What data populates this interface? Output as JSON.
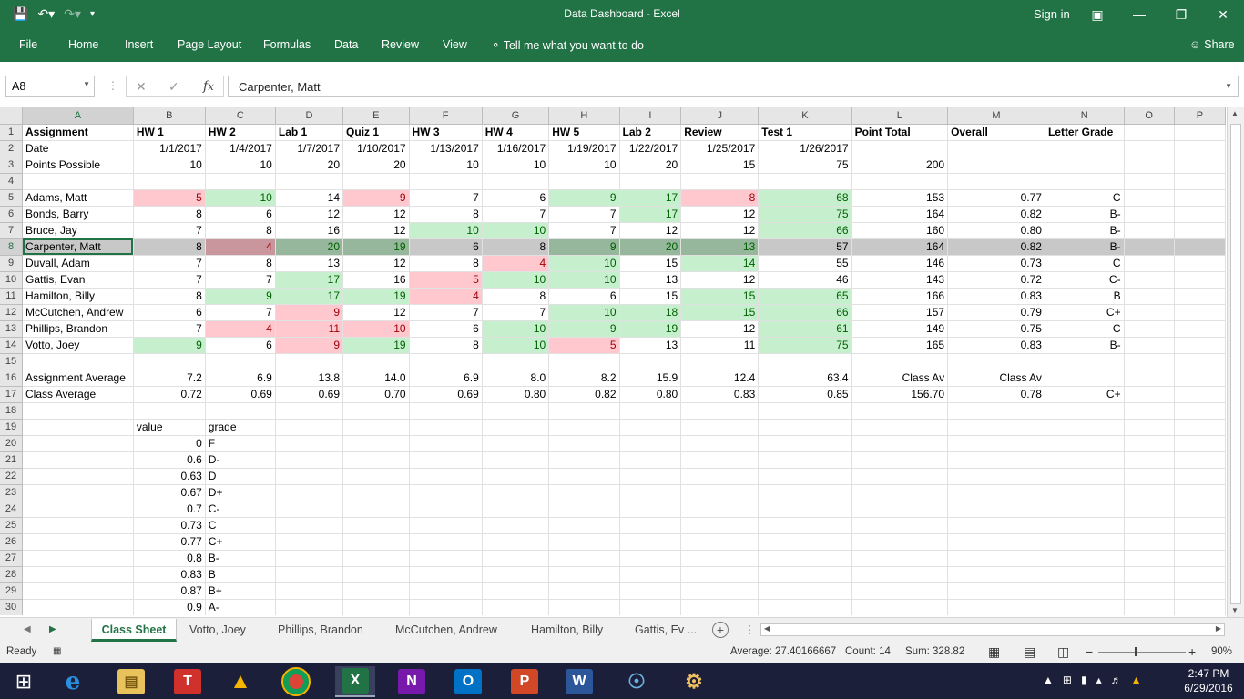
{
  "window": {
    "title": "Data Dashboard - Excel",
    "sign_in": "Sign in"
  },
  "ribbon": {
    "tabs": [
      "File",
      "Home",
      "Insert",
      "Page Layout",
      "Formulas",
      "Data",
      "Review",
      "View"
    ],
    "tell_me": "Tell me what you want to do",
    "share": "Share"
  },
  "formula_bar": {
    "name_box": "A8",
    "value": "Carpenter, Matt"
  },
  "columns": [
    "A",
    "B",
    "C",
    "D",
    "E",
    "F",
    "G",
    "H",
    "I",
    "J",
    "K",
    "L",
    "M",
    "N",
    "O",
    "P"
  ],
  "rows": [
    {
      "n": "1",
      "cells": [
        {
          "v": "Assignment",
          "b": 1
        },
        {
          "v": "HW 1",
          "b": 1
        },
        {
          "v": "HW 2",
          "b": 1
        },
        {
          "v": "Lab 1",
          "b": 1
        },
        {
          "v": "Quiz 1",
          "b": 1
        },
        {
          "v": "HW 3",
          "b": 1
        },
        {
          "v": "HW 4",
          "b": 1
        },
        {
          "v": "HW 5",
          "b": 1
        },
        {
          "v": "Lab 2",
          "b": 1
        },
        {
          "v": "Review",
          "b": 1
        },
        {
          "v": "Test 1",
          "b": 1
        },
        {
          "v": "Point Total",
          "b": 1
        },
        {
          "v": "Overall",
          "b": 1
        },
        {
          "v": "Letter Grade",
          "b": 1
        },
        {
          "v": ""
        },
        {
          "v": ""
        }
      ]
    },
    {
      "n": "2",
      "cells": [
        {
          "v": "Date"
        },
        {
          "v": "1/1/2017",
          "r": 1
        },
        {
          "v": "1/4/2017",
          "r": 1
        },
        {
          "v": "1/7/2017",
          "r": 1
        },
        {
          "v": "1/10/2017",
          "r": 1
        },
        {
          "v": "1/13/2017",
          "r": 1
        },
        {
          "v": "1/16/2017",
          "r": 1
        },
        {
          "v": "1/19/2017",
          "r": 1
        },
        {
          "v": "1/22/2017",
          "r": 1
        },
        {
          "v": "1/25/2017",
          "r": 1
        },
        {
          "v": "1/26/2017",
          "r": 1
        },
        {
          "v": ""
        },
        {
          "v": ""
        },
        {
          "v": ""
        },
        {
          "v": ""
        },
        {
          "v": ""
        }
      ]
    },
    {
      "n": "3",
      "cells": [
        {
          "v": "Points Possible"
        },
        {
          "v": "10",
          "r": 1
        },
        {
          "v": "10",
          "r": 1
        },
        {
          "v": "20",
          "r": 1
        },
        {
          "v": "20",
          "r": 1
        },
        {
          "v": "10",
          "r": 1
        },
        {
          "v": "10",
          "r": 1
        },
        {
          "v": "10",
          "r": 1
        },
        {
          "v": "20",
          "r": 1
        },
        {
          "v": "15",
          "r": 1
        },
        {
          "v": "75",
          "r": 1
        },
        {
          "v": "200",
          "r": 1
        },
        {
          "v": ""
        },
        {
          "v": ""
        },
        {
          "v": ""
        },
        {
          "v": ""
        }
      ]
    },
    {
      "n": "4",
      "cells": []
    },
    {
      "n": "5",
      "cells": [
        {
          "v": "Adams, Matt"
        },
        {
          "v": "5",
          "r": 1,
          "c": "cr"
        },
        {
          "v": "10",
          "r": 1,
          "c": "cg"
        },
        {
          "v": "14",
          "r": 1
        },
        {
          "v": "9",
          "r": 1,
          "c": "cr"
        },
        {
          "v": "7",
          "r": 1
        },
        {
          "v": "6",
          "r": 1
        },
        {
          "v": "9",
          "r": 1,
          "c": "cg"
        },
        {
          "v": "17",
          "r": 1,
          "c": "cg"
        },
        {
          "v": "8",
          "r": 1,
          "c": "cr"
        },
        {
          "v": "68",
          "r": 1,
          "c": "cg"
        },
        {
          "v": "153",
          "r": 1
        },
        {
          "v": "0.77",
          "r": 1
        },
        {
          "v": "C",
          "r": 1
        },
        {
          "v": ""
        },
        {
          "v": ""
        }
      ]
    },
    {
      "n": "6",
      "cells": [
        {
          "v": "Bonds, Barry"
        },
        {
          "v": "8",
          "r": 1
        },
        {
          "v": "6",
          "r": 1
        },
        {
          "v": "12",
          "r": 1
        },
        {
          "v": "12",
          "r": 1
        },
        {
          "v": "8",
          "r": 1
        },
        {
          "v": "7",
          "r": 1
        },
        {
          "v": "7",
          "r": 1
        },
        {
          "v": "17",
          "r": 1,
          "c": "cg"
        },
        {
          "v": "12",
          "r": 1
        },
        {
          "v": "75",
          "r": 1,
          "c": "cg"
        },
        {
          "v": "164",
          "r": 1
        },
        {
          "v": "0.82",
          "r": 1
        },
        {
          "v": "B-",
          "r": 1
        },
        {
          "v": ""
        },
        {
          "v": ""
        }
      ]
    },
    {
      "n": "7",
      "cells": [
        {
          "v": "Bruce, Jay"
        },
        {
          "v": "7",
          "r": 1
        },
        {
          "v": "8",
          "r": 1
        },
        {
          "v": "16",
          "r": 1
        },
        {
          "v": "12",
          "r": 1
        },
        {
          "v": "10",
          "r": 1,
          "c": "cg"
        },
        {
          "v": "10",
          "r": 1,
          "c": "cg"
        },
        {
          "v": "7",
          "r": 1
        },
        {
          "v": "12",
          "r": 1
        },
        {
          "v": "12",
          "r": 1
        },
        {
          "v": "66",
          "r": 1,
          "c": "cg"
        },
        {
          "v": "160",
          "r": 1
        },
        {
          "v": "0.80",
          "r": 1
        },
        {
          "v": "B-",
          "r": 1
        },
        {
          "v": ""
        },
        {
          "v": ""
        }
      ]
    },
    {
      "n": "8",
      "sel": 1,
      "cells": [
        {
          "v": "Carpenter, Matt",
          "active": 1
        },
        {
          "v": "8",
          "r": 1
        },
        {
          "v": "4",
          "r": 1,
          "c": "cr"
        },
        {
          "v": "20",
          "r": 1,
          "c": "cg"
        },
        {
          "v": "19",
          "r": 1,
          "c": "cg"
        },
        {
          "v": "6",
          "r": 1
        },
        {
          "v": "8",
          "r": 1
        },
        {
          "v": "9",
          "r": 1,
          "c": "cg"
        },
        {
          "v": "20",
          "r": 1,
          "c": "cg"
        },
        {
          "v": "13",
          "r": 1,
          "c": "cg"
        },
        {
          "v": "57",
          "r": 1
        },
        {
          "v": "164",
          "r": 1
        },
        {
          "v": "0.82",
          "r": 1
        },
        {
          "v": "B-",
          "r": 1
        },
        {
          "v": ""
        },
        {
          "v": ""
        }
      ]
    },
    {
      "n": "9",
      "cells": [
        {
          "v": "Duvall, Adam"
        },
        {
          "v": "7",
          "r": 1
        },
        {
          "v": "8",
          "r": 1
        },
        {
          "v": "13",
          "r": 1
        },
        {
          "v": "12",
          "r": 1
        },
        {
          "v": "8",
          "r": 1
        },
        {
          "v": "4",
          "r": 1,
          "c": "cr"
        },
        {
          "v": "10",
          "r": 1,
          "c": "cg"
        },
        {
          "v": "15",
          "r": 1
        },
        {
          "v": "14",
          "r": 1,
          "c": "cg"
        },
        {
          "v": "55",
          "r": 1
        },
        {
          "v": "146",
          "r": 1
        },
        {
          "v": "0.73",
          "r": 1
        },
        {
          "v": "C",
          "r": 1
        },
        {
          "v": ""
        },
        {
          "v": ""
        }
      ]
    },
    {
      "n": "10",
      "cells": [
        {
          "v": "Gattis, Evan"
        },
        {
          "v": "7",
          "r": 1
        },
        {
          "v": "7",
          "r": 1
        },
        {
          "v": "17",
          "r": 1,
          "c": "cg"
        },
        {
          "v": "16",
          "r": 1
        },
        {
          "v": "5",
          "r": 1,
          "c": "cr"
        },
        {
          "v": "10",
          "r": 1,
          "c": "cg"
        },
        {
          "v": "10",
          "r": 1,
          "c": "cg"
        },
        {
          "v": "13",
          "r": 1
        },
        {
          "v": "12",
          "r": 1
        },
        {
          "v": "46",
          "r": 1
        },
        {
          "v": "143",
          "r": 1
        },
        {
          "v": "0.72",
          "r": 1
        },
        {
          "v": "C-",
          "r": 1
        },
        {
          "v": ""
        },
        {
          "v": ""
        }
      ]
    },
    {
      "n": "11",
      "cells": [
        {
          "v": "Hamilton, Billy"
        },
        {
          "v": "8",
          "r": 1
        },
        {
          "v": "9",
          "r": 1,
          "c": "cg"
        },
        {
          "v": "17",
          "r": 1,
          "c": "cg"
        },
        {
          "v": "19",
          "r": 1,
          "c": "cg"
        },
        {
          "v": "4",
          "r": 1,
          "c": "cr"
        },
        {
          "v": "8",
          "r": 1
        },
        {
          "v": "6",
          "r": 1
        },
        {
          "v": "15",
          "r": 1
        },
        {
          "v": "15",
          "r": 1,
          "c": "cg"
        },
        {
          "v": "65",
          "r": 1,
          "c": "cg"
        },
        {
          "v": "166",
          "r": 1
        },
        {
          "v": "0.83",
          "r": 1
        },
        {
          "v": "B",
          "r": 1
        },
        {
          "v": ""
        },
        {
          "v": ""
        }
      ]
    },
    {
      "n": "12",
      "cells": [
        {
          "v": "McCutchen, Andrew"
        },
        {
          "v": "6",
          "r": 1
        },
        {
          "v": "7",
          "r": 1
        },
        {
          "v": "9",
          "r": 1,
          "c": "cr"
        },
        {
          "v": "12",
          "r": 1
        },
        {
          "v": "7",
          "r": 1
        },
        {
          "v": "7",
          "r": 1
        },
        {
          "v": "10",
          "r": 1,
          "c": "cg"
        },
        {
          "v": "18",
          "r": 1,
          "c": "cg"
        },
        {
          "v": "15",
          "r": 1,
          "c": "cg"
        },
        {
          "v": "66",
          "r": 1,
          "c": "cg"
        },
        {
          "v": "157",
          "r": 1
        },
        {
          "v": "0.79",
          "r": 1
        },
        {
          "v": "C+",
          "r": 1
        },
        {
          "v": ""
        },
        {
          "v": ""
        }
      ]
    },
    {
      "n": "13",
      "cells": [
        {
          "v": "Phillips, Brandon"
        },
        {
          "v": "7",
          "r": 1
        },
        {
          "v": "4",
          "r": 1,
          "c": "cr"
        },
        {
          "v": "11",
          "r": 1,
          "c": "cr"
        },
        {
          "v": "10",
          "r": 1,
          "c": "cr"
        },
        {
          "v": "6",
          "r": 1
        },
        {
          "v": "10",
          "r": 1,
          "c": "cg"
        },
        {
          "v": "9",
          "r": 1,
          "c": "cg"
        },
        {
          "v": "19",
          "r": 1,
          "c": "cg"
        },
        {
          "v": "12",
          "r": 1
        },
        {
          "v": "61",
          "r": 1,
          "c": "cg"
        },
        {
          "v": "149",
          "r": 1
        },
        {
          "v": "0.75",
          "r": 1
        },
        {
          "v": "C",
          "r": 1
        },
        {
          "v": ""
        },
        {
          "v": ""
        }
      ]
    },
    {
      "n": "14",
      "cells": [
        {
          "v": "Votto, Joey"
        },
        {
          "v": "9",
          "r": 1,
          "c": "cg"
        },
        {
          "v": "6",
          "r": 1
        },
        {
          "v": "9",
          "r": 1,
          "c": "cr"
        },
        {
          "v": "19",
          "r": 1,
          "c": "cg"
        },
        {
          "v": "8",
          "r": 1
        },
        {
          "v": "10",
          "r": 1,
          "c": "cg"
        },
        {
          "v": "5",
          "r": 1,
          "c": "cr"
        },
        {
          "v": "13",
          "r": 1
        },
        {
          "v": "11",
          "r": 1
        },
        {
          "v": "75",
          "r": 1,
          "c": "cg"
        },
        {
          "v": "165",
          "r": 1
        },
        {
          "v": "0.83",
          "r": 1
        },
        {
          "v": "B-",
          "r": 1
        },
        {
          "v": ""
        },
        {
          "v": ""
        }
      ]
    },
    {
      "n": "15",
      "cells": []
    },
    {
      "n": "16",
      "cells": [
        {
          "v": "Assignment Average"
        },
        {
          "v": "7.2",
          "r": 1
        },
        {
          "v": "6.9",
          "r": 1
        },
        {
          "v": "13.8",
          "r": 1
        },
        {
          "v": "14.0",
          "r": 1
        },
        {
          "v": "6.9",
          "r": 1
        },
        {
          "v": "8.0",
          "r": 1
        },
        {
          "v": "8.2",
          "r": 1
        },
        {
          "v": "15.9",
          "r": 1
        },
        {
          "v": "12.4",
          "r": 1
        },
        {
          "v": "63.4",
          "r": 1
        },
        {
          "v": "Class Av",
          "r": 1
        },
        {
          "v": "Class Av",
          "r": 1
        },
        {
          "v": ""
        },
        {
          "v": ""
        },
        {
          "v": ""
        }
      ]
    },
    {
      "n": "17",
      "cells": [
        {
          "v": "Class Average"
        },
        {
          "v": "0.72",
          "r": 1
        },
        {
          "v": "0.69",
          "r": 1
        },
        {
          "v": "0.69",
          "r": 1
        },
        {
          "v": "0.70",
          "r": 1
        },
        {
          "v": "0.69",
          "r": 1
        },
        {
          "v": "0.80",
          "r": 1
        },
        {
          "v": "0.82",
          "r": 1
        },
        {
          "v": "0.80",
          "r": 1
        },
        {
          "v": "0.83",
          "r": 1
        },
        {
          "v": "0.85",
          "r": 1
        },
        {
          "v": "156.70",
          "r": 1
        },
        {
          "v": "0.78",
          "r": 1
        },
        {
          "v": "C+",
          "r": 1
        },
        {
          "v": ""
        },
        {
          "v": ""
        }
      ]
    },
    {
      "n": "18",
      "cells": []
    },
    {
      "n": "19",
      "cells": [
        {
          "v": ""
        },
        {
          "v": "value"
        },
        {
          "v": "grade"
        }
      ]
    },
    {
      "n": "20",
      "cells": [
        {
          "v": ""
        },
        {
          "v": "0",
          "r": 1
        },
        {
          "v": "F"
        }
      ]
    },
    {
      "n": "21",
      "cells": [
        {
          "v": ""
        },
        {
          "v": "0.6",
          "r": 1
        },
        {
          "v": "D-"
        }
      ]
    },
    {
      "n": "22",
      "cells": [
        {
          "v": ""
        },
        {
          "v": "0.63",
          "r": 1
        },
        {
          "v": "D"
        }
      ]
    },
    {
      "n": "23",
      "cells": [
        {
          "v": ""
        },
        {
          "v": "0.67",
          "r": 1
        },
        {
          "v": "D+"
        }
      ]
    },
    {
      "n": "24",
      "cells": [
        {
          "v": ""
        },
        {
          "v": "0.7",
          "r": 1
        },
        {
          "v": "C-"
        }
      ]
    },
    {
      "n": "25",
      "cells": [
        {
          "v": ""
        },
        {
          "v": "0.73",
          "r": 1
        },
        {
          "v": "C"
        }
      ]
    },
    {
      "n": "26",
      "cells": [
        {
          "v": ""
        },
        {
          "v": "0.77",
          "r": 1
        },
        {
          "v": "C+"
        }
      ]
    },
    {
      "n": "27",
      "cells": [
        {
          "v": ""
        },
        {
          "v": "0.8",
          "r": 1
        },
        {
          "v": "B-"
        }
      ]
    },
    {
      "n": "28",
      "cells": [
        {
          "v": ""
        },
        {
          "v": "0.83",
          "r": 1
        },
        {
          "v": "B"
        }
      ]
    },
    {
      "n": "29",
      "cells": [
        {
          "v": ""
        },
        {
          "v": "0.87",
          "r": 1
        },
        {
          "v": "B+"
        }
      ]
    },
    {
      "n": "30",
      "cells": [
        {
          "v": ""
        },
        {
          "v": "0.9",
          "r": 1
        },
        {
          "v": "A-"
        }
      ]
    }
  ],
  "sheet_tabs": [
    "Class Sheet",
    "Votto, Joey",
    "Phillips, Brandon",
    "McCutchen, Andrew",
    "Hamilton, Billy",
    "Gattis, Ev ..."
  ],
  "status": {
    "ready": "Ready",
    "average": "Average: 27.40166667",
    "count": "Count: 14",
    "sum": "Sum: 328.82",
    "zoom": "90%"
  },
  "clock": {
    "time": "2:47 PM",
    "date": "6/29/2016"
  },
  "colors": {
    "excel_green": "#217346",
    "bad_fill": "#ffc7ce",
    "good_fill": "#c6efce"
  }
}
